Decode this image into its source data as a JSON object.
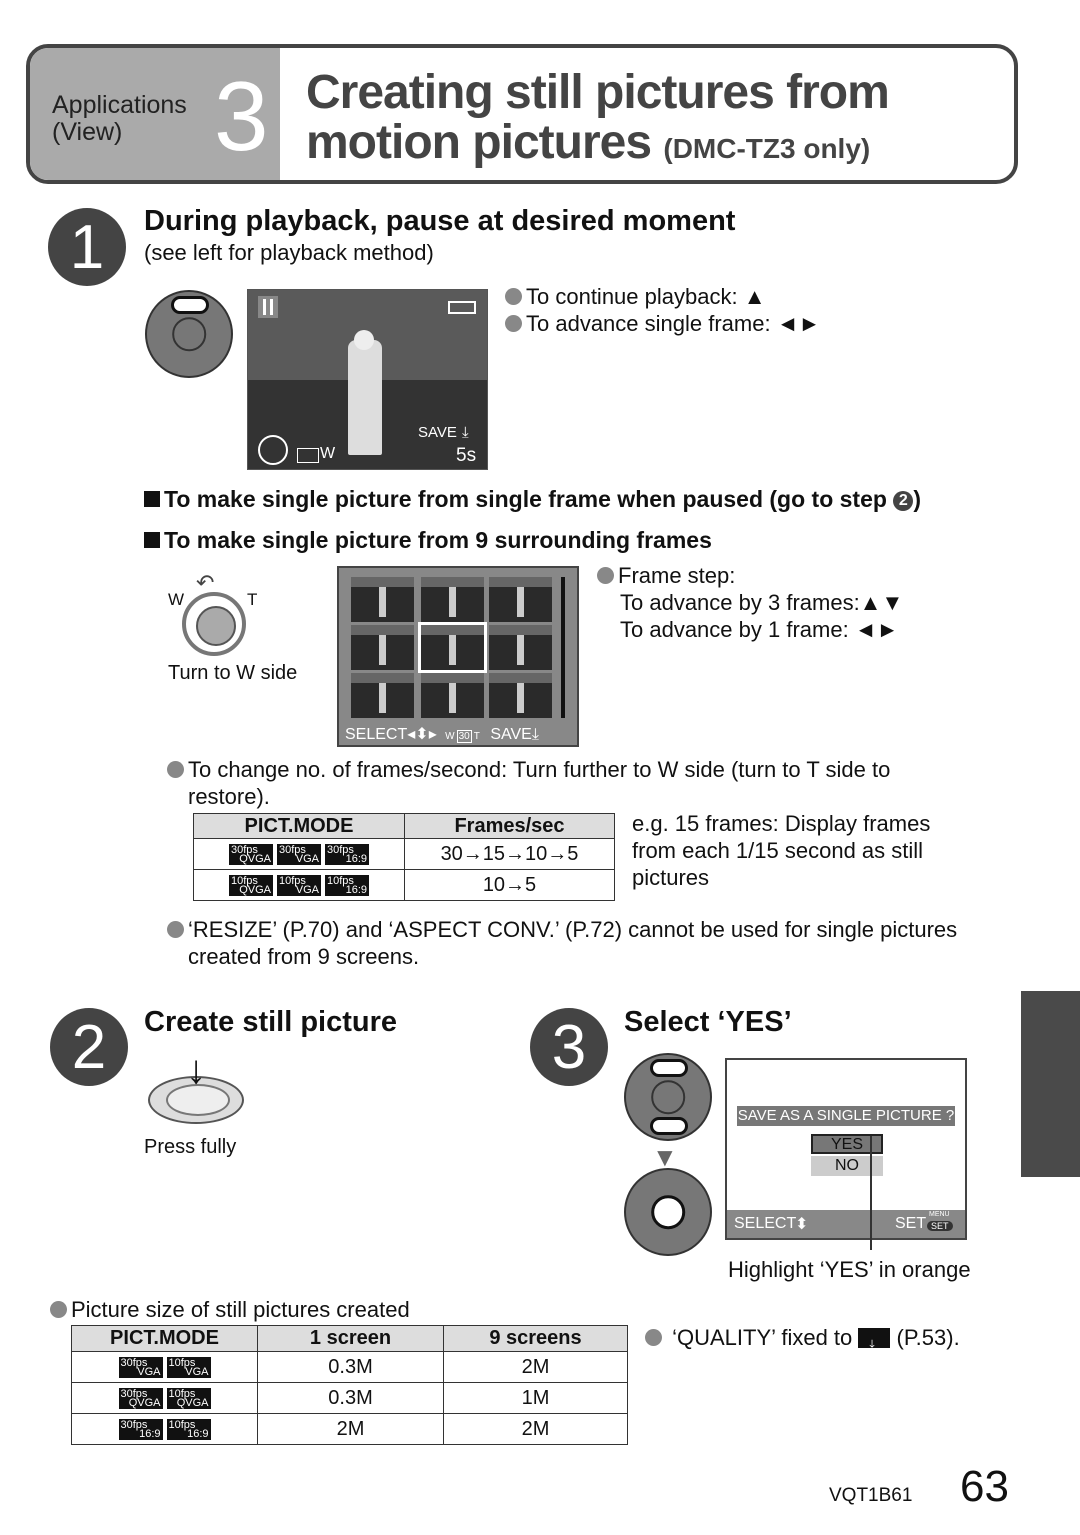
{
  "header": {
    "category_line1": "Applications",
    "category_line2": "(View)",
    "chapter_number": "3",
    "title_line1": "Creating still pictures from",
    "title_line2": "motion pictures",
    "title_note": "(DMC-TZ3 only)"
  },
  "step1": {
    "number": "1",
    "heading": "During playback, pause at desired moment",
    "subheading": "(see left for playback method)",
    "screen": {
      "save_label": "SAVE",
      "time": "5s",
      "zoom_label": "W"
    },
    "bullets": [
      "To continue playback: ▲",
      "To advance single frame: ◄►"
    ],
    "option_single": "To make single picture from single frame when paused (go to step ",
    "option_single_ref": "2",
    "option_single_end": ")",
    "option_nine": "To make single picture from 9 surrounding frames",
    "lever_w": "W",
    "lever_t": "T",
    "lever_caption": "Turn to W side",
    "grid_screen": {
      "select_label": "SELECT",
      "fps_label": "30",
      "save_label": "SAVE",
      "w": "W",
      "t": "T"
    },
    "frame_step_title": "Frame step:",
    "frame_step_lines": [
      "To advance by 3 frames:▲▼",
      "To advance by 1 frame: ◄►"
    ],
    "change_fps_note": "To change no. of frames/second: Turn further to W side (turn to T side to restore).",
    "fps_table": {
      "headers": [
        "PICT.MODE",
        "Frames/sec"
      ],
      "rows": [
        {
          "modes": [
            [
              "30fps",
              "QVGA"
            ],
            [
              "30fps",
              "VGA"
            ],
            [
              "30fps",
              "16:9"
            ]
          ],
          "value": "30→15→10→5"
        },
        {
          "modes": [
            [
              "10fps",
              "QVGA"
            ],
            [
              "10fps",
              "VGA"
            ],
            [
              "10fps",
              "16:9"
            ]
          ],
          "value": "10→5"
        }
      ]
    },
    "example_note": "e.g. 15 frames: Display frames from each 1/15 second as still pictures",
    "resize_note": "‘RESIZE’ (P.70) and ‘ASPECT CONV.’ (P.72) cannot be used for single pictures created from 9 screens."
  },
  "step2": {
    "number": "2",
    "heading": "Create still picture",
    "caption": "Press fully"
  },
  "step3": {
    "number": "3",
    "heading": "Select ‘YES’",
    "dialog": {
      "prompt": "SAVE AS A SINGLE PICTURE ?",
      "yes": "YES",
      "no": "NO",
      "select_label": "SELECT",
      "set_label": "SET",
      "menu_label": "MENU",
      "set_badge": "SET"
    },
    "callout": "Highlight ‘YES’ in orange"
  },
  "size_section": {
    "title": "Picture size of still pictures created",
    "headers": [
      "PICT.MODE",
      "1 screen",
      "9 screens"
    ],
    "rows": [
      {
        "modes": [
          [
            "30fps",
            "VGA"
          ],
          [
            "10fps",
            "VGA"
          ]
        ],
        "one": "0.3M",
        "nine": "2M"
      },
      {
        "modes": [
          [
            "30fps",
            "QVGA"
          ],
          [
            "10fps",
            "QVGA"
          ]
        ],
        "one": "0.3M",
        "nine": "1M"
      },
      {
        "modes": [
          [
            "30fps",
            "16:9"
          ],
          [
            "10fps",
            "16:9"
          ]
        ],
        "one": "2M",
        "nine": "2M"
      }
    ],
    "quality_note_before": "‘QUALITY’ fixed to",
    "quality_note_after": "(P.53)."
  },
  "footer": {
    "code": "VQT1B61",
    "page": "63"
  }
}
